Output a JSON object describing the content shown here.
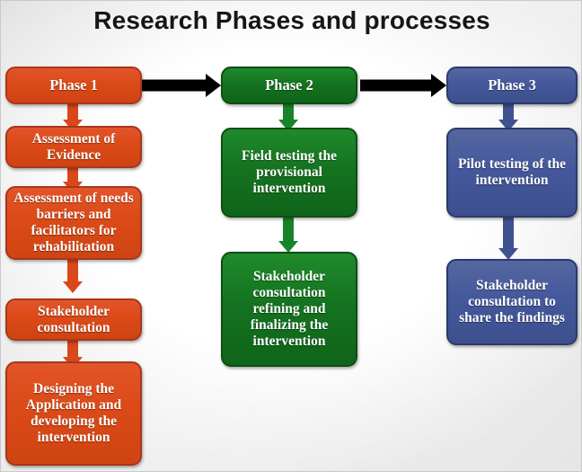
{
  "title": "Research Phases and processes",
  "colors": {
    "orange": "#D9471A",
    "green": "#157320",
    "blue": "#45589C",
    "arrow_black": "#000000",
    "background": "#EDEDED",
    "text": "#FFFFFF"
  },
  "columns": [
    {
      "id": "phase-1",
      "color": "orange",
      "header": "Phase 1",
      "steps": [
        "Assessment of Evidence",
        "Assessment of needs barriers and facilitators for rehabilitation",
        "Stakeholder consultation",
        "Designing the Application and developing the intervention"
      ]
    },
    {
      "id": "phase-2",
      "color": "green",
      "header": "Phase 2",
      "steps": [
        "Field testing the provisional intervention",
        "Stakeholder consultation refining and finalizing the intervention"
      ]
    },
    {
      "id": "phase-3",
      "color": "blue",
      "header": "Phase 3",
      "steps": [
        "Pilot testing of the intervention",
        "Stakeholder consultation to share the findings"
      ]
    }
  ],
  "connectors": {
    "horizontal_1_to_2": "arrow-right",
    "horizontal_2_to_3": "arrow-right",
    "vertical": "arrow-down"
  }
}
